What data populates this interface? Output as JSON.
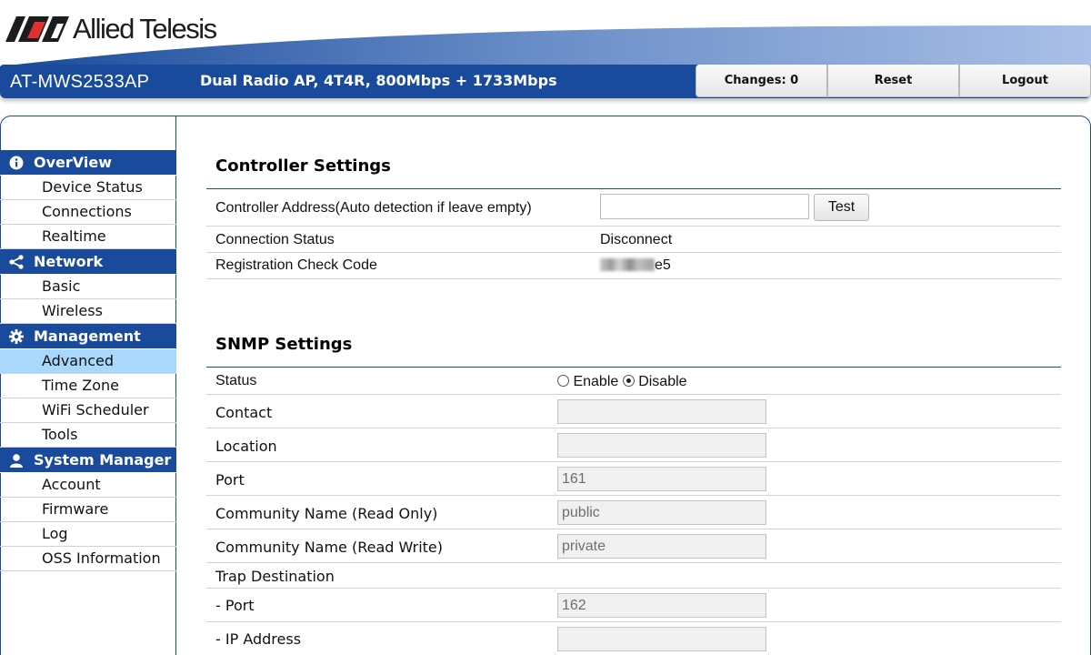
{
  "brand": {
    "logo_text": "Allied Telesis",
    "color": "#1a4a9c"
  },
  "header": {
    "model": "AT-MWS2533AP",
    "description": "Dual Radio AP, 4T4R, 800Mbps + 1733Mbps",
    "buttons": {
      "changes": "Changes: 0",
      "reset": "Reset",
      "logout": "Logout"
    }
  },
  "sidebar": {
    "groups": [
      {
        "title": "OverView",
        "icon": "info-icon",
        "items": [
          "Device Status",
          "Connections",
          "Realtime"
        ]
      },
      {
        "title": "Network",
        "icon": "share-icon",
        "items": [
          "Basic",
          "Wireless"
        ]
      },
      {
        "title": "Management",
        "icon": "gear-icon",
        "items": [
          "Advanced",
          "Time Zone",
          "WiFi Scheduler",
          "Tools"
        ]
      },
      {
        "title": "System Manager",
        "icon": "user-icon",
        "items": [
          "Account",
          "Firmware",
          "Log",
          "OSS Information"
        ]
      }
    ],
    "active_item": "Advanced"
  },
  "controller": {
    "title": "Controller Settings",
    "address_label": "Controller Address(Auto detection if leave empty)",
    "address_value": "",
    "test_label": "Test",
    "status_label": "Connection Status",
    "status_value": "Disconnect",
    "code_label": "Registration Check Code",
    "code_suffix": "e5"
  },
  "snmp": {
    "title": "SNMP Settings",
    "status_label": "Status",
    "enable_label": "Enable",
    "disable_label": "Disable",
    "selected": "Disable",
    "contact_label": "Contact",
    "contact_value": "",
    "location_label": "Location",
    "location_value": "",
    "port_label": "Port",
    "port_value": "161",
    "ro_label": "Community Name (Read Only)",
    "ro_value": "public",
    "rw_label": "Community Name (Read Write)",
    "rw_value": "private",
    "trap_label": "Trap Destination",
    "trap_port_label": "- Port",
    "trap_port_value": "162",
    "trap_ip_label": "- IP Address",
    "trap_ip_value": ""
  }
}
